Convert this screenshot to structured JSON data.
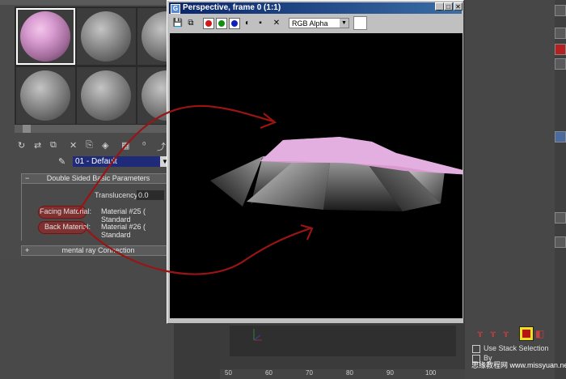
{
  "render_window": {
    "title": "Perspective, frame 0 (1:1)",
    "channel": "RGB Alpha",
    "icons": [
      "save-icon",
      "clone-icon",
      "red-channel-icon",
      "green-channel-icon",
      "blue-channel-icon",
      "mono-icon",
      "alpha-icon",
      "clear-icon"
    ],
    "colors": {
      "red": "#d01818",
      "green": "#109010",
      "blue": "#1020c0"
    }
  },
  "material_editor": {
    "material_name": "01 - Default",
    "rollout_title": "Double Sided Basic Parameters",
    "translucency_label": "Translucency:",
    "translucency_value": "0.0",
    "facing_label": "Facing Material:",
    "facing_value": "Material #25  ( Standard",
    "back_label": "Back Material:",
    "back_value": "Material #26  ( Standard",
    "mr_rollout_title": "mental ray Connection"
  },
  "right_panel": {
    "use_stack_label": "Use Stack Selection",
    "by_label": "By",
    "watermark": "思缘教程网  www.missyuan.net"
  },
  "track": {
    "ruler": [
      "50",
      "60",
      "70",
      "80",
      "90",
      "100"
    ]
  }
}
